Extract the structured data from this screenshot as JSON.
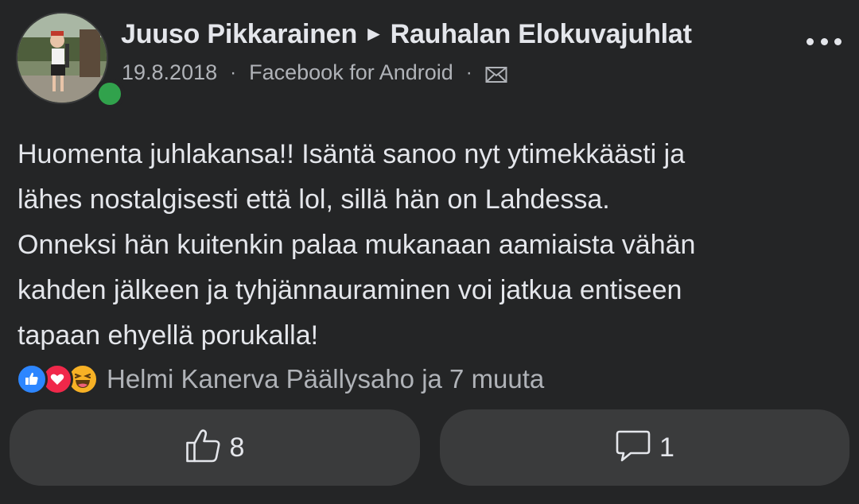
{
  "post": {
    "author": "Juuso Pikkarainen",
    "arrow": "►",
    "group": "Rauhalan Elokuvajuhlat",
    "date": "19.8.2018",
    "separator": "·",
    "source": "Facebook for Android",
    "privacy_icon": "envelope-icon",
    "online_status": "online",
    "text": "Huomenta juhlakansa!! Isäntä sanoo nyt ytimekkäästi ja\nlähes nostalgisesti että lol, sillä hän on Lahdessa.\nOnneksi hän kuitenkin palaa mukanaan aamiaista vähän\nkahden jälkeen ja tyhjännauraminen voi jatkua entiseen\ntapaan ehyellä porukalla!"
  },
  "reactions": {
    "types": [
      "like",
      "love",
      "haha"
    ],
    "names": "Helmi Kanerva Päällysaho ja 7 muuta"
  },
  "actions": {
    "like_count": "8",
    "comment_count": "1"
  },
  "colors": {
    "background": "#242526",
    "button_background": "#3a3b3c",
    "primary_text": "#e4e6eb",
    "secondary_text": "#b0b3b8",
    "online": "#31a24c",
    "like": "#2d86ff",
    "love": "#f0284a",
    "haha": "#f7b125"
  }
}
